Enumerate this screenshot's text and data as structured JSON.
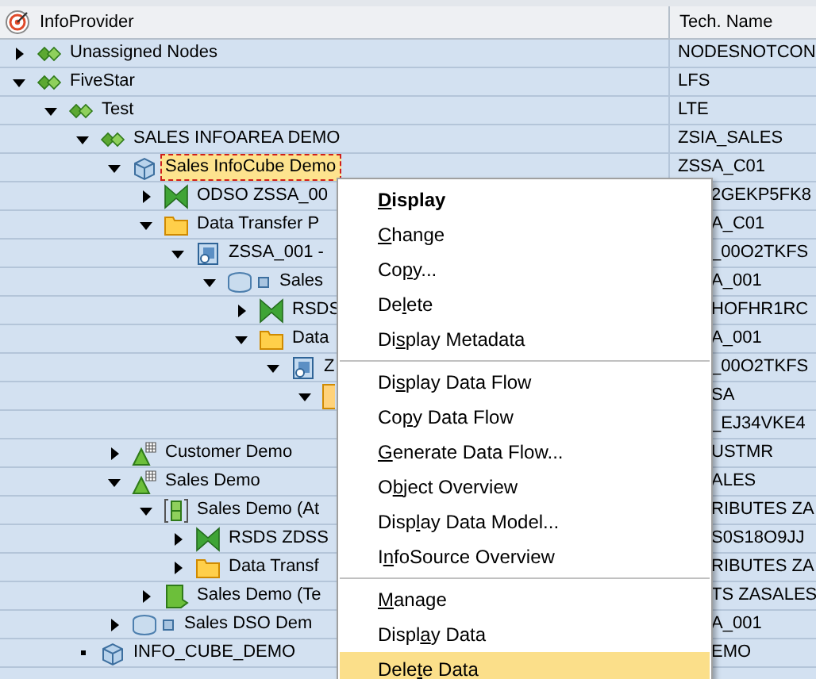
{
  "header": {
    "title": "InfoProvider",
    "tech_column": "Tech. Name"
  },
  "tree": [
    {
      "label": "Unassigned Nodes",
      "tech_name": "NODESNOTCON",
      "kind": "infoarea",
      "expanded": false,
      "covered": false,
      "selected": false
    },
    {
      "label": "FiveStar",
      "tech_name": "LFS",
      "kind": "infoarea",
      "expanded": true,
      "covered": false,
      "selected": false,
      "children": [
        {
          "label": "Test",
          "tech_name": "LTE",
          "kind": "infoarea",
          "expanded": true,
          "covered": false,
          "selected": false,
          "children": [
            {
              "label": "SALES INFOAREA DEMO",
              "tech_name": "ZSIA_SALES",
              "kind": "infoarea",
              "expanded": true,
              "covered": false,
              "selected": false,
              "children": [
                {
                  "label": "Sales InfoCube Demo",
                  "tech_name": "ZSSA_C01",
                  "kind": "infocube",
                  "expanded": true,
                  "covered": false,
                  "selected": true,
                  "children": [
                    {
                      "label": "ODSO ZSSA_00",
                      "tech_name": "2GEKP5FK8",
                      "kind": "transformation",
                      "expanded": false,
                      "covered": true,
                      "selected": false
                    },
                    {
                      "label": "Data Transfer P",
                      "tech_name": "A_C01",
                      "kind": "folder",
                      "expanded": true,
                      "covered": true,
                      "selected": false,
                      "children": [
                        {
                          "label": "ZSSA_001 -",
                          "tech_name": "_00O2TKFS",
                          "kind": "dtp",
                          "expanded": true,
                          "covered": true,
                          "selected": false,
                          "children": [
                            {
                              "label": "Sales",
                              "tech_name": "A_001",
                              "kind": "datasource",
                              "expanded": true,
                              "covered": true,
                              "selected": false,
                              "children": [
                                {
                                  "label": "RSDS",
                                  "tech_name": "HOFHR1RC",
                                  "kind": "transformation",
                                  "expanded": false,
                                  "covered": true,
                                  "selected": false
                                },
                                {
                                  "label": "Data",
                                  "tech_name": "A_001",
                                  "kind": "folder",
                                  "expanded": true,
                                  "covered": true,
                                  "selected": false,
                                  "children": [
                                    {
                                      "label": "Z",
                                      "tech_name": "_00O2TKFS",
                                      "kind": "dtp",
                                      "expanded": true,
                                      "covered": true,
                                      "selected": false,
                                      "children": [
                                        {
                                          "tech_name": "SA",
                                          "kind": "query",
                                          "expanded": true,
                                          "covered": true,
                                          "children": [
                                            {
                                              "tech_name": "_EJ34VKE4",
                                              "covered": true
                                            }
                                          ]
                                        }
                                      ]
                                    }
                                  ]
                                }
                              ]
                            }
                          ]
                        }
                      ]
                    }
                  ]
                },
                {
                  "label": "Customer Demo",
                  "tech_name": "USTMR",
                  "kind": "infoobject",
                  "expanded": false,
                  "covered": true,
                  "selected": false
                },
                {
                  "label": "Sales Demo",
                  "tech_name": "ALES",
                  "kind": "infoobject",
                  "expanded": true,
                  "covered": true,
                  "selected": false,
                  "children": [
                    {
                      "label": "Sales Demo (At",
                      "tech_name": "RIBUTES ZA",
                      "kind": "attributes",
                      "expanded": true,
                      "covered": true,
                      "selected": false,
                      "children": [
                        {
                          "label": "RSDS ZDSS",
                          "tech_name": "S0S18O9JJ",
                          "kind": "transformation",
                          "expanded": false,
                          "covered": true,
                          "selected": false
                        },
                        {
                          "label": "Data Transf",
                          "tech_name": "RIBUTES ZA",
                          "kind": "folder",
                          "expanded": false,
                          "covered": true,
                          "selected": false
                        }
                      ]
                    },
                    {
                      "label": "Sales Demo (Te",
                      "tech_name": "TS ZASALES",
                      "kind": "texts",
                      "expanded": false,
                      "covered": true,
                      "selected": false
                    }
                  ]
                },
                {
                  "label": "Sales DSO Dem",
                  "tech_name": "A_001",
                  "kind": "datasource",
                  "expanded": false,
                  "covered": true,
                  "selected": false
                }
              ]
            },
            {
              "label": "INFO_CUBE_DEMO",
              "tech_name": "EMO",
              "kind": "infocube",
              "covered": true,
              "selected": false
            }
          ]
        }
      ]
    }
  ],
  "context_menu": {
    "groups": [
      [
        {
          "parts": {
            "key": "D",
            "after": "isplay"
          },
          "default": true,
          "selected": false
        },
        {
          "parts": {
            "key": "C",
            "after": "hange"
          },
          "default": false,
          "selected": false
        },
        {
          "parts": {
            "before": "Co",
            "key": "p",
            "after": "y..."
          },
          "default": false,
          "selected": false
        },
        {
          "parts": {
            "before": "De",
            "key": "l",
            "after": "ete"
          },
          "default": false,
          "selected": false
        },
        {
          "parts": {
            "before": "Di",
            "key": "s",
            "after": "play Metadata"
          },
          "default": false,
          "selected": false
        }
      ],
      [
        {
          "parts": {
            "before": "Di",
            "key": "s",
            "after": "play Data Flow"
          },
          "default": false,
          "selected": false
        },
        {
          "parts": {
            "before": "Co",
            "key": "p",
            "after": "y Data Flow"
          },
          "default": false,
          "selected": false
        },
        {
          "parts": {
            "key": "G",
            "after": "enerate Data Flow..."
          },
          "default": false,
          "selected": false
        },
        {
          "parts": {
            "before": "O",
            "key": "b",
            "after": "ject Overview"
          },
          "default": false,
          "selected": false
        },
        {
          "parts": {
            "before": "Disp",
            "key": "l",
            "after": "ay Data Model..."
          },
          "default": false,
          "selected": false
        },
        {
          "parts": {
            "before": "I",
            "key": "n",
            "after": "foSource Overview"
          },
          "default": false,
          "selected": false
        }
      ],
      [
        {
          "parts": {
            "key": "M",
            "after": "anage"
          },
          "default": false,
          "selected": false
        },
        {
          "parts": {
            "before": "Displ",
            "key": "a",
            "after": "y Data"
          },
          "default": false,
          "selected": false
        },
        {
          "parts": {
            "before": "Dele",
            "key": "t",
            "after": "e Data"
          },
          "default": false,
          "selected": true
        }
      ]
    ]
  }
}
